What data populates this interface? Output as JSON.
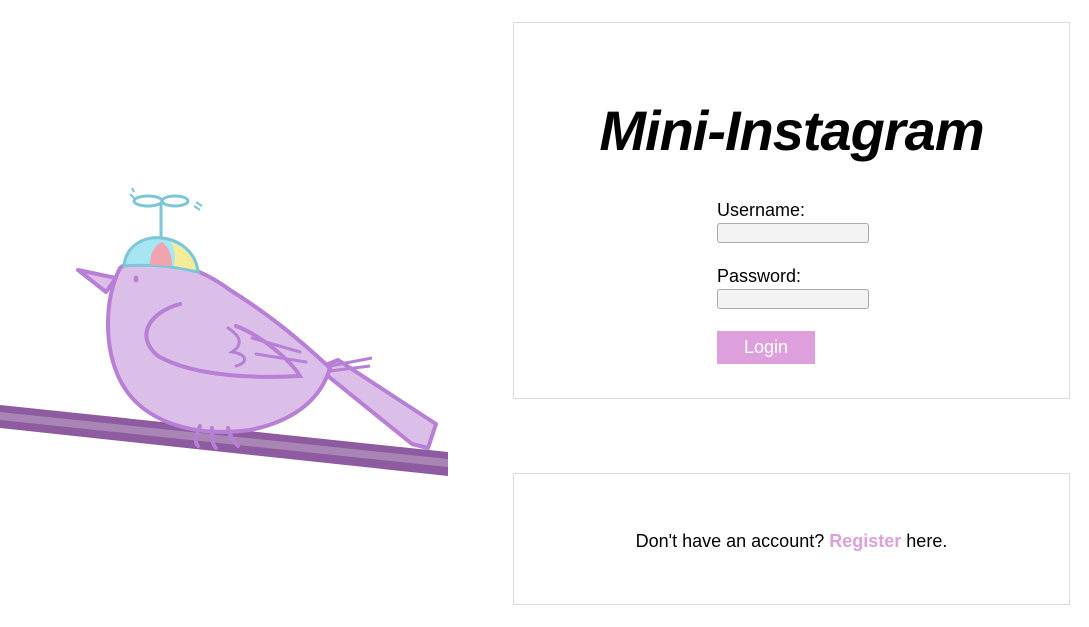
{
  "illustration": {
    "icon": "bird-with-propeller-cap-illustration",
    "colors": {
      "bird_body": "#dbbfe9",
      "bird_outline": "#b77fd6",
      "branch": "#8e5aa0",
      "cap_blue": "#a6e6f2",
      "cap_pink": "#f2a3b0",
      "cap_yellow": "#f3ed9b"
    }
  },
  "login": {
    "title": "Mini-Instagram",
    "username_label": "Username:",
    "username_value": "",
    "password_label": "Password:",
    "password_value": "",
    "login_button": "Login"
  },
  "register": {
    "prefix": "Don't have an account?",
    "link": "Register",
    "suffix": "here."
  },
  "colors": {
    "accent": "#dda0dd",
    "border": "#d9d9d9"
  }
}
